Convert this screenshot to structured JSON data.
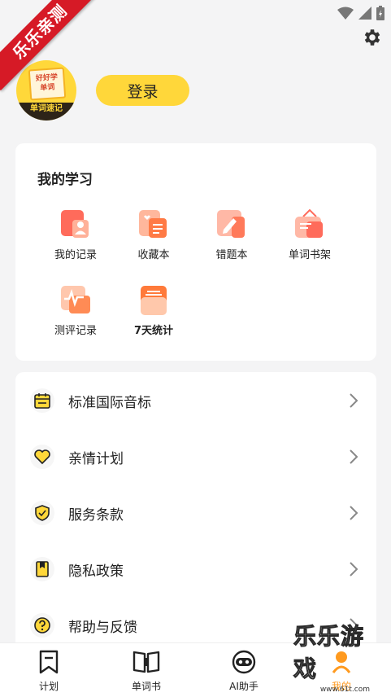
{
  "watermark_ribbon": "乐乐亲测",
  "profile": {
    "avatar_line1": "好好学",
    "avatar_line2": "单词",
    "avatar_band": "单词速记",
    "login_label": "登录"
  },
  "study": {
    "title": "我的学习",
    "items": [
      {
        "label": "我的记录",
        "icon": "record-icon"
      },
      {
        "label": "收藏本",
        "icon": "favorites-icon"
      },
      {
        "label": "错题本",
        "icon": "mistakes-icon"
      },
      {
        "label": "单词书架",
        "icon": "bookshelf-icon"
      },
      {
        "label": "测评记录",
        "icon": "assessment-icon"
      },
      {
        "label": "7天统计",
        "icon": "stats-icon"
      }
    ]
  },
  "menu": [
    {
      "label": "标准国际音标",
      "icon": "calendar-icon"
    },
    {
      "label": "亲情计划",
      "icon": "heart-icon"
    },
    {
      "label": "服务条款",
      "icon": "shield-check-icon"
    },
    {
      "label": "隐私政策",
      "icon": "bookmark-icon"
    },
    {
      "label": "帮助与反馈",
      "icon": "help-icon"
    }
  ],
  "tabs": [
    {
      "label": "计划",
      "icon": "plan-icon"
    },
    {
      "label": "单词书",
      "icon": "book-icon"
    },
    {
      "label": "AI助手",
      "icon": "robot-icon"
    },
    {
      "label": "我的",
      "icon": "profile-icon"
    }
  ],
  "watermark_site": {
    "name": "乐乐游戏",
    "url": "www.61t.com"
  },
  "colors": {
    "accent": "#ffd73a",
    "icon_orange": "#ff7a45",
    "ribbon": "#d61a26"
  }
}
